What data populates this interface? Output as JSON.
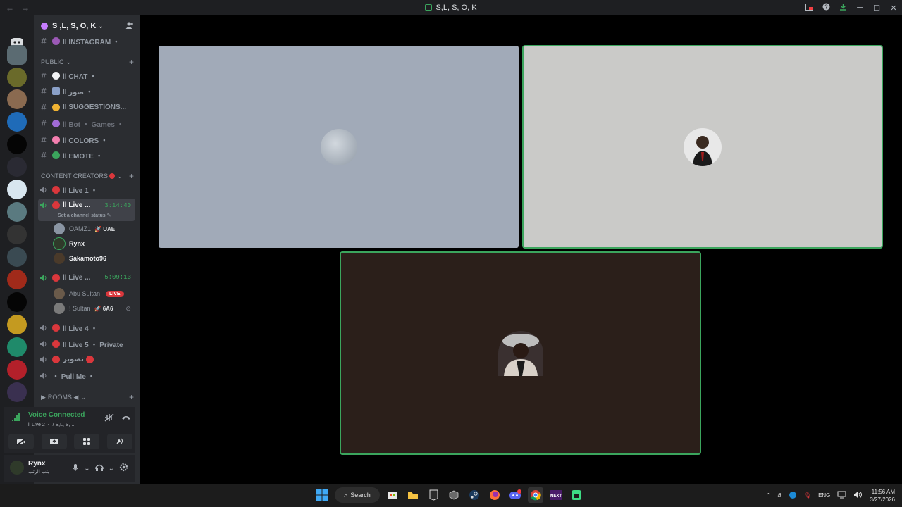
{
  "window": {
    "title": "S,L, S, O, K"
  },
  "server": {
    "name": "S ,L, S, O, K"
  },
  "channels": {
    "top": {
      "label": "ll INSTAGRAM ・"
    },
    "public_label": "PUBLIC",
    "public": [
      {
        "label": "ll CHAT ・",
        "color": "#f2f3f5",
        "muted": false
      },
      {
        "label": "ll صور ・",
        "color": "#8aa0c8",
        "muted": false
      },
      {
        "label": "ll SUGGESTIONS...",
        "color": "#f0b232",
        "muted": false
      },
      {
        "label": "ll Bot ・ Games ・",
        "color": "#a16bd6",
        "muted": true
      },
      {
        "label": "ll COLORS ・",
        "color": "#f47fb0",
        "muted": false
      },
      {
        "label": "ll EMOTE ・",
        "color": "#3ba55d",
        "muted": false
      }
    ],
    "content_label": "CONTENT CREATORS",
    "voice": {
      "live1": "ll Live 1 ・",
      "live2": "ll Live ...",
      "live2_timer": "3:14:40",
      "live2_status": "Set a channel status",
      "live2_users": [
        {
          "name": "OAMZ1",
          "tag": "UAE"
        },
        {
          "name": "Rynx",
          "tag": ""
        },
        {
          "name": "Sakamoto96",
          "tag": ""
        }
      ],
      "live3": "ll Live ...",
      "live3_timer": "5:09:13",
      "live3_users": [
        {
          "name": "Abu Sultan",
          "badge": "LIVE"
        },
        {
          "name": "! Sultan",
          "tag": "6A6"
        }
      ],
      "live4": "ll Live 4 ・",
      "live5": "ll Live 5 ・ Private",
      "tasweer": "تصوير",
      "pullme": "・ Pull Me ・"
    },
    "rooms_label": "ROOMS ◀"
  },
  "voice_panel": {
    "status": "Voice Connected",
    "channel": "ll Live 2 ・ / S,L, S, ..."
  },
  "user": {
    "name": "Rynx",
    "status": "بتب الرتب"
  },
  "taskbar": {
    "search": "Search",
    "lang": "ENG",
    "time": "11:56 AM",
    "date": "3/27/2026"
  }
}
